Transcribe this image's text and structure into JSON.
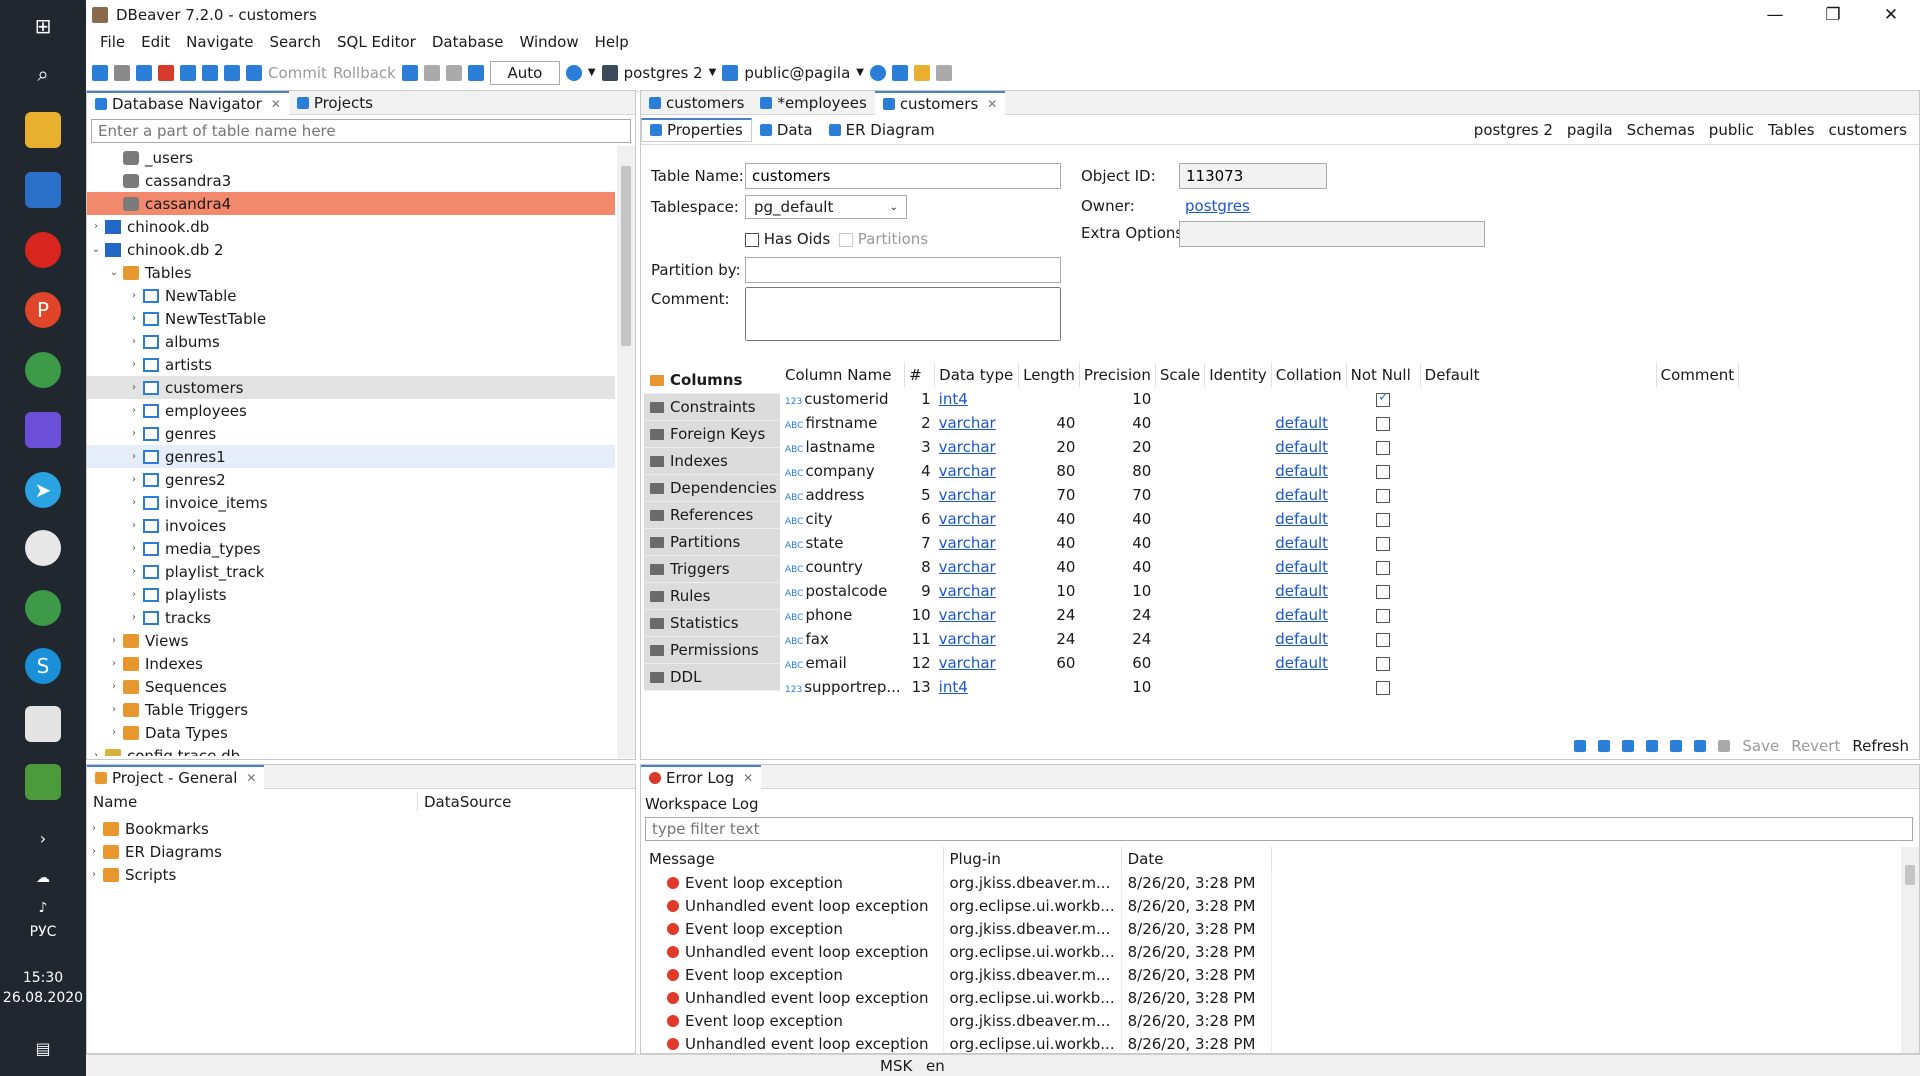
{
  "taskbar": {
    "lang": "РУС",
    "time": "15:30",
    "date": "26.08.2020"
  },
  "window": {
    "title": "DBeaver 7.2.0 - customers"
  },
  "menu": [
    "File",
    "Edit",
    "Navigate",
    "Search",
    "SQL Editor",
    "Database",
    "Window",
    "Help"
  ],
  "toolbar": {
    "commit": "Commit",
    "rollback": "Rollback",
    "mode": "Auto",
    "connection": "postgres 2",
    "schema": "public@pagila"
  },
  "navigator": {
    "tab": "Database Navigator",
    "tab2": "Projects",
    "filter_placeholder": "Enter a part of table name here",
    "items": [
      "_users",
      "cassandra3",
      "cassandra4",
      "chinook.db",
      "chinook.db 2",
      "Tables",
      "NewTable",
      "NewTestTable",
      "albums",
      "artists",
      "customers",
      "employees",
      "genres",
      "genres1",
      "genres2",
      "invoice_items",
      "invoices",
      "media_types",
      "playlist_track",
      "playlists",
      "tracks",
      "Views",
      "Indexes",
      "Sequences",
      "Table Triggers",
      "Data Types",
      "config.trace.db"
    ]
  },
  "project": {
    "tab": "Project - General",
    "col_name": "Name",
    "col_ds": "DataSource",
    "items": [
      "Bookmarks",
      "ER Diagrams",
      "Scripts"
    ]
  },
  "editor": {
    "tabs": [
      "customers",
      "*employees",
      "customers"
    ],
    "subtabs": [
      "Properties",
      "Data",
      "ER Diagram"
    ],
    "breadcrumb": [
      "postgres 2",
      "pagila",
      "Schemas",
      "public",
      "Tables",
      "customers"
    ],
    "labels": {
      "table_name": "Table Name:",
      "tablespace": "Tablespace:",
      "has_oids": "Has Oids",
      "partitions": "Partitions",
      "partition_by": "Partition by:",
      "comment": "Comment:",
      "object_id": "Object ID:",
      "owner": "Owner:",
      "extra": "Extra Options:"
    },
    "values": {
      "table_name": "customers",
      "tablespace": "pg_default",
      "object_id": "113073",
      "owner": "postgres"
    },
    "side": [
      "Columns",
      "Constraints",
      "Foreign Keys",
      "Indexes",
      "Dependencies",
      "References",
      "Partitions",
      "Triggers",
      "Rules",
      "Statistics",
      "Permissions",
      "DDL"
    ],
    "headers": [
      "Column Name",
      "#",
      "Data type",
      "Length",
      "Precision",
      "Scale",
      "Identity",
      "Collation",
      "Not Null",
      "Default",
      "Comment"
    ],
    "rows": [
      {
        "t": "123",
        "name": "customerid",
        "n": "1",
        "type": "int4",
        "len": "",
        "prec": "10",
        "coll": "",
        "nn": true
      },
      {
        "t": "ABC",
        "name": "firstname",
        "n": "2",
        "type": "varchar",
        "len": "40",
        "prec": "40",
        "coll": "default",
        "nn": false
      },
      {
        "t": "ABC",
        "name": "lastname",
        "n": "3",
        "type": "varchar",
        "len": "20",
        "prec": "20",
        "coll": "default",
        "nn": false
      },
      {
        "t": "ABC",
        "name": "company",
        "n": "4",
        "type": "varchar",
        "len": "80",
        "prec": "80",
        "coll": "default",
        "nn": false
      },
      {
        "t": "ABC",
        "name": "address",
        "n": "5",
        "type": "varchar",
        "len": "70",
        "prec": "70",
        "coll": "default",
        "nn": false
      },
      {
        "t": "ABC",
        "name": "city",
        "n": "6",
        "type": "varchar",
        "len": "40",
        "prec": "40",
        "coll": "default",
        "nn": false
      },
      {
        "t": "ABC",
        "name": "state",
        "n": "7",
        "type": "varchar",
        "len": "40",
        "prec": "40",
        "coll": "default",
        "nn": false
      },
      {
        "t": "ABC",
        "name": "country",
        "n": "8",
        "type": "varchar",
        "len": "40",
        "prec": "40",
        "coll": "default",
        "nn": false
      },
      {
        "t": "ABC",
        "name": "postalcode",
        "n": "9",
        "type": "varchar",
        "len": "10",
        "prec": "10",
        "coll": "default",
        "nn": false
      },
      {
        "t": "ABC",
        "name": "phone",
        "n": "10",
        "type": "varchar",
        "len": "24",
        "prec": "24",
        "coll": "default",
        "nn": false
      },
      {
        "t": "ABC",
        "name": "fax",
        "n": "11",
        "type": "varchar",
        "len": "24",
        "prec": "24",
        "coll": "default",
        "nn": false
      },
      {
        "t": "ABC",
        "name": "email",
        "n": "12",
        "type": "varchar",
        "len": "60",
        "prec": "60",
        "coll": "default",
        "nn": false
      },
      {
        "t": "123",
        "name": "supportrep...",
        "n": "13",
        "type": "int4",
        "len": "",
        "prec": "10",
        "coll": "",
        "nn": false
      }
    ],
    "bottom": {
      "save": "Save",
      "revert": "Revert",
      "refresh": "Refresh"
    }
  },
  "errorlog": {
    "tab": "Error Log",
    "workspace": "Workspace Log",
    "filter_placeholder": "type filter text",
    "headers": [
      "Message",
      "Plug-in",
      "Date"
    ],
    "rows": [
      {
        "msg": "Event loop exception",
        "plugin": "org.jkiss.dbeaver.m...",
        "date": "8/26/20, 3:28 PM"
      },
      {
        "msg": "Unhandled event loop exception",
        "plugin": "org.eclipse.ui.workb...",
        "date": "8/26/20, 3:28 PM"
      },
      {
        "msg": "Event loop exception",
        "plugin": "org.jkiss.dbeaver.m...",
        "date": "8/26/20, 3:28 PM"
      },
      {
        "msg": "Unhandled event loop exception",
        "plugin": "org.eclipse.ui.workb...",
        "date": "8/26/20, 3:28 PM"
      },
      {
        "msg": "Event loop exception",
        "plugin": "org.jkiss.dbeaver.m...",
        "date": "8/26/20, 3:28 PM"
      },
      {
        "msg": "Unhandled event loop exception",
        "plugin": "org.eclipse.ui.workb...",
        "date": "8/26/20, 3:28 PM"
      },
      {
        "msg": "Event loop exception",
        "plugin": "org.jkiss.dbeaver.m...",
        "date": "8/26/20, 3:28 PM"
      },
      {
        "msg": "Unhandled event loop exception",
        "plugin": "org.eclipse.ui.workb...",
        "date": "8/26/20, 3:28 PM"
      }
    ]
  },
  "status": {
    "tz": "MSK",
    "locale": "en"
  },
  "colors": {
    "accent": "#4a7fc9",
    "selected": "#f2896c",
    "taskbar": "#20272f"
  }
}
